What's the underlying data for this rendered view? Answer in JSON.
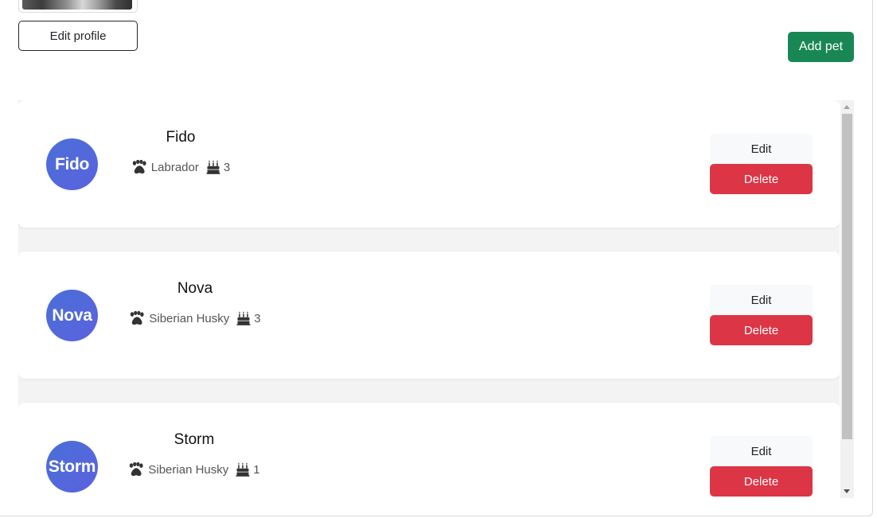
{
  "profile": {
    "edit_label": "Edit profile"
  },
  "actions": {
    "add_pet_label": "Add pet"
  },
  "pets": [
    {
      "avatar_text": "Fido",
      "name": "Fido",
      "breed": "Labrador",
      "age": "3",
      "edit_label": "Edit",
      "delete_label": "Delete"
    },
    {
      "avatar_text": "Nova",
      "name": "Nova",
      "breed": "Siberian Husky",
      "age": "3",
      "edit_label": "Edit",
      "delete_label": "Delete"
    },
    {
      "avatar_text": "Storm",
      "name": "Storm",
      "breed": "Siberian Husky",
      "age": "1",
      "edit_label": "Edit",
      "delete_label": "Delete"
    }
  ],
  "colors": {
    "primary_green": "#198754",
    "danger_red": "#dc3545",
    "avatar_blue": "#4a6fd8",
    "light_button": "#f8f9fa"
  },
  "icons": {
    "breed": "paw-icon",
    "age": "birthday-cake-icon"
  }
}
